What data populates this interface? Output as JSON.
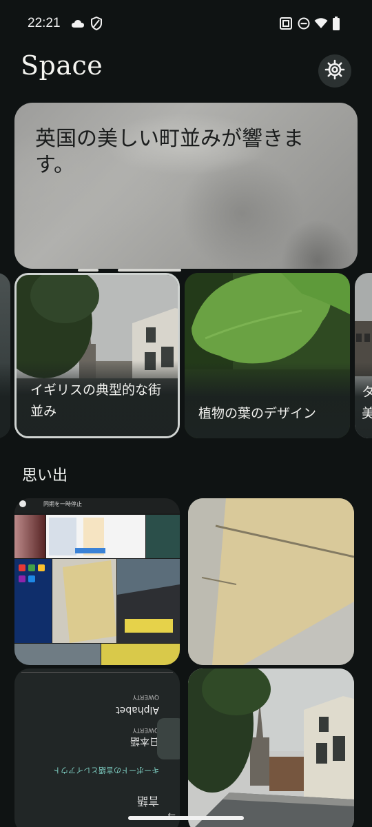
{
  "status_bar": {
    "time": "22:21",
    "icons": [
      "cloud-icon",
      "shield-icon",
      "nfc-icon",
      "do-not-disturb-icon",
      "wifi-icon",
      "battery-icon"
    ]
  },
  "header": {
    "title": "Space",
    "settings_icon": "gear-icon"
  },
  "hero": {
    "text": "英国の美しい町並みが響きます。"
  },
  "topics": [
    {
      "label": "イギリスの典型的な街並み"
    },
    {
      "label": "植物の葉のデザイン"
    },
    {
      "label": "タ 美"
    }
  ],
  "memories": {
    "title": "思い出",
    "items": [
      {
        "type": "screenshot-collage",
        "pause_text": "同期を一時停止"
      },
      {
        "type": "photo-wall"
      },
      {
        "type": "keyboard-screenshot",
        "lines": [
          "QWERTY",
          "Alphabet",
          "QWERTY",
          "日本語",
          "キーボードの言語とレイアウト",
          "言語"
        ]
      },
      {
        "type": "photo-street"
      }
    ]
  },
  "colors": {
    "background": "#0f1313",
    "hero_card": "#a6a6a3",
    "settings_button": "#2b3131"
  }
}
